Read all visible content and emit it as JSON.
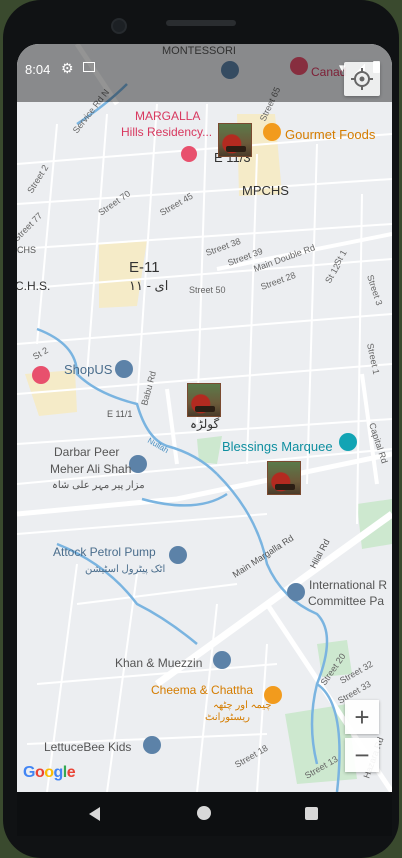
{
  "status": {
    "time": "8:04"
  },
  "map": {
    "labels": {
      "montessori": "MONTESSORI",
      "canada": "Canad",
      "service_rd": "Service Rd N",
      "margalla_1": "MARGALLA",
      "margalla_2": "Hills Residency...",
      "e11_3": "E 11/3",
      "gourmet": "Gourmet Foods",
      "mpchs": "MPCHS",
      "street_65": "Street 65",
      "street_2": "Street 2",
      "street_77": "Street 77",
      "street_70": "Street 70",
      "street_45": "Street 45",
      "street_38": "Street 38",
      "street_39": "Street 39",
      "main_double": "Main Double Rd",
      "street_28": "Street 28",
      "st_1": "St 1",
      "st_12": "St 12",
      "street_3": "Street 3",
      "chs_top": "CHS",
      "e11": "E-11",
      "e11_urdu": "ای - ۱۱",
      "chs": "C.H.S.",
      "street_50": "Street 50",
      "st_2": "St 2",
      "shopus": "ShopUS",
      "street_1": "Street 1",
      "babu_rd": "Babu Rd",
      "e11_1": "E 11/1",
      "golra": "گولڑہ",
      "nullah": "Nullah",
      "capital_rd": "Capital Rd",
      "blessings": "Blessings Marquee",
      "darbar_1": "Darbar Peer",
      "darbar_2": "Meher Ali Shah",
      "darbar_urdu": "مزار پیر مہر علی شاہ",
      "attock": "Attock Petrol Pump",
      "attock_urdu": "اٹک پیٹرول اسٹیشن",
      "main_margalla": "Main Margalla Rd",
      "hilal_rd": "Hilal Rd",
      "international_1": "International R",
      "international_2": "Committee Pa",
      "khan": "Khan & Muezzin",
      "street_20": "Street 20",
      "street_32": "Street 32",
      "cheema": "Cheema & Chattha",
      "cheema_urdu_1": "چیمہ اور چٹھہ",
      "cheema_urdu_2": "ریسٹورانٹ",
      "street_33": "Street 33",
      "lettuce": "LettuceBee Kids",
      "street_18": "Street 18",
      "street_13": "Street 13",
      "hazara": "Hazara Rd"
    }
  },
  "controls": {
    "zoom_in": "+",
    "zoom_out": "−"
  },
  "google": "Google",
  "colors": {
    "map_bg": "#eceef1",
    "road": "#ffffff",
    "water": "#7ab4e0",
    "park": "#cde8cf",
    "residential": "#f5ebc8",
    "poi_red": "#e8506d",
    "poi_orange": "#f29b1d",
    "poi_blue": "#5c82a8",
    "poi_teal": "#12a4b4"
  }
}
